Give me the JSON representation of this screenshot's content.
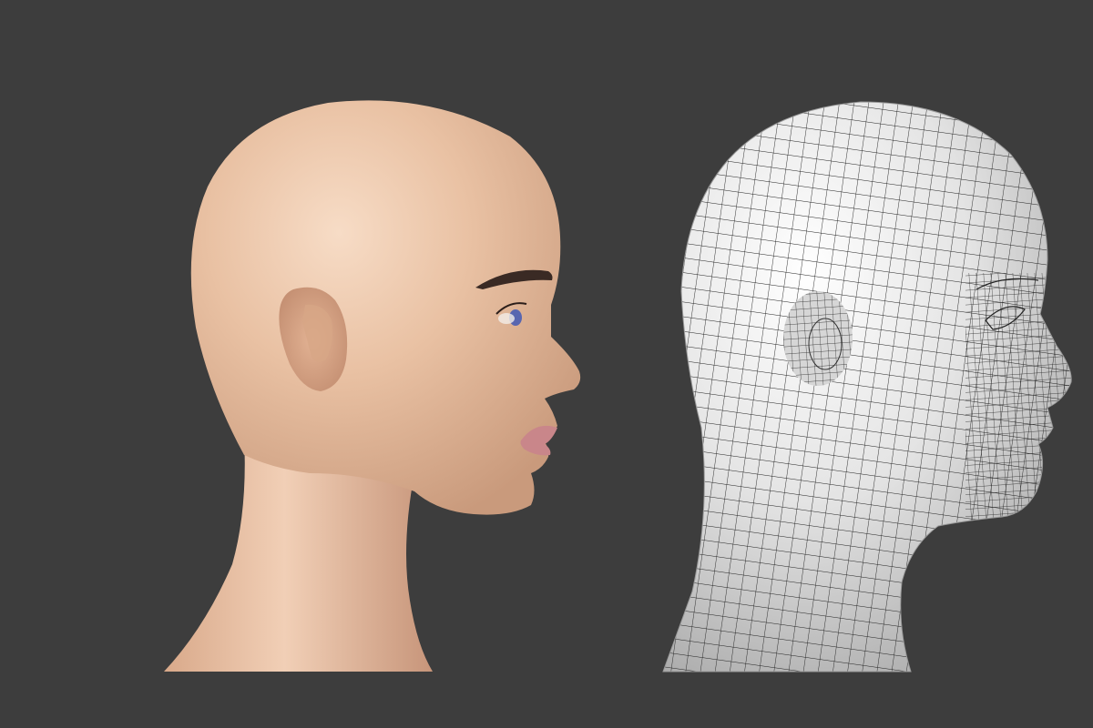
{
  "scene": {
    "background_color": "#3d3d3d",
    "renders": [
      {
        "name": "shaded-render",
        "shading": "skin",
        "skin_color": "#e9c1a3",
        "lip_color": "#c9868a",
        "iris_color": "#5866b0",
        "brow_color": "#3a2a24"
      },
      {
        "name": "wireframe-render",
        "shading": "wireframe",
        "surface_color": "#e8e8e8",
        "wire_color": "#1f1f1f"
      }
    ]
  }
}
